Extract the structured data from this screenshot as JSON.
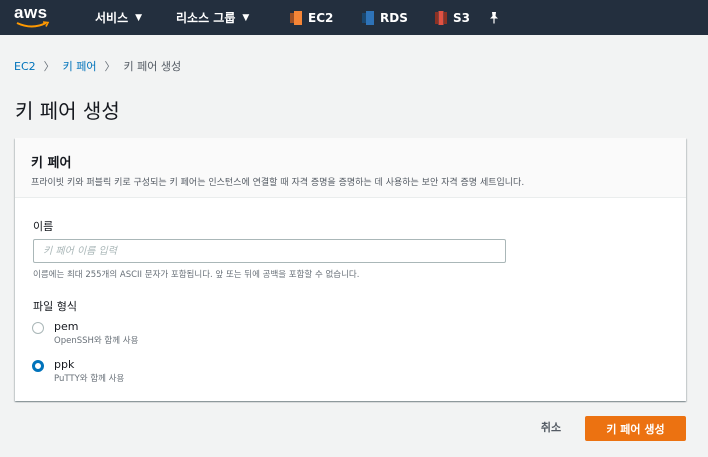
{
  "nav": {
    "logo_text": "aws",
    "services_label": "서비스",
    "resource_groups_label": "리소스 그룹",
    "shortcuts": [
      {
        "label": "EC2",
        "icon": "ec2-icon",
        "color": "#f58536"
      },
      {
        "label": "RDS",
        "icon": "rds-icon",
        "color": "#2e73b8"
      },
      {
        "label": "S3",
        "icon": "s3-icon",
        "color": "#e05243"
      }
    ],
    "pin_icon": "pin-icon"
  },
  "breadcrumb": {
    "items": [
      "EC2",
      "키 페어",
      "키 페어 생성"
    ]
  },
  "page": {
    "title": "키 페어 생성"
  },
  "panel": {
    "title": "키 페어",
    "description": "프라이빗 키와 퍼블릭 키로 구성되는 키 페어는 인스턴스에 연결할 때 자격 증명을 증명하는 데 사용하는 보안 자격 증명 세트입니다.",
    "name_label": "이름",
    "name_value": "",
    "name_placeholder": "키 페어 이름 입력",
    "name_hint": "이름에는 최대 255개의 ASCII 문자가 포함됩니다. 앞 또는 뒤에 공백을 포함할 수 없습니다.",
    "format_label": "파일 형식",
    "formats": [
      {
        "label": "pem",
        "desc": "OpenSSH와 함께 사용",
        "selected": false
      },
      {
        "label": "ppk",
        "desc": "PuTTY와 함께 사용",
        "selected": true
      }
    ]
  },
  "actions": {
    "cancel_label": "취소",
    "create_label": "키 페어 생성"
  },
  "colors": {
    "nav_bg": "#232f3e",
    "accent": "#ec7211",
    "link": "#0073bb"
  }
}
